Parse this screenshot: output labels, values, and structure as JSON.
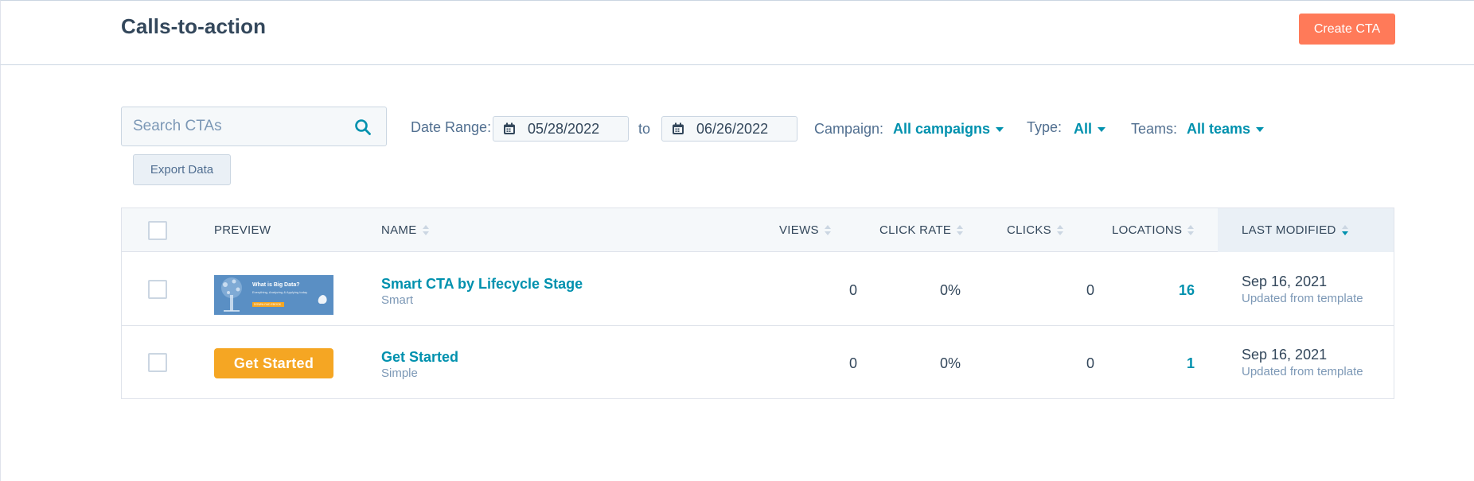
{
  "header": {
    "title": "Calls-to-action",
    "create_label": "Create CTA"
  },
  "filters": {
    "search_placeholder": "Search CTAs",
    "search_value": "",
    "date_range_label": "Date Range:",
    "date_from": "05/28/2022",
    "to_label": "to",
    "date_to": "06/26/2022",
    "campaign_label": "Campaign:",
    "campaign_value": "All campaigns",
    "type_label": "Type:",
    "type_value": "All",
    "teams_label": "Teams:",
    "teams_value": "All teams",
    "export_label": "Export Data"
  },
  "table": {
    "columns": {
      "preview": "Preview",
      "name": "Name",
      "views": "Views",
      "click_rate": "Click Rate",
      "clicks": "Clicks",
      "locations": "Locations",
      "last_modified": "Last Modified"
    },
    "rows": [
      {
        "name": "Smart CTA by Lifecycle Stage",
        "type": "Smart",
        "preview": {
          "kind": "image",
          "title": "What is Big Data?",
          "subtitle": "Everything, Analyzing & Applying today",
          "button": "DOWNLOAD EBOOK"
        },
        "views": "0",
        "click_rate": "0%",
        "clicks": "0",
        "locations": "16",
        "modified_date": "Sep 16, 2021",
        "modified_note": "Updated from template"
      },
      {
        "name": "Get Started",
        "type": "Simple",
        "preview": {
          "kind": "button",
          "label": "Get Started"
        },
        "views": "0",
        "click_rate": "0%",
        "clicks": "0",
        "locations": "1",
        "modified_date": "Sep 16, 2021",
        "modified_note": "Updated from template"
      }
    ]
  },
  "colors": {
    "accent": "#0091ae",
    "primary_button": "#ff7a59",
    "preview_button": "#f5a623",
    "text": "#33475b",
    "muted": "#7c98b6"
  }
}
